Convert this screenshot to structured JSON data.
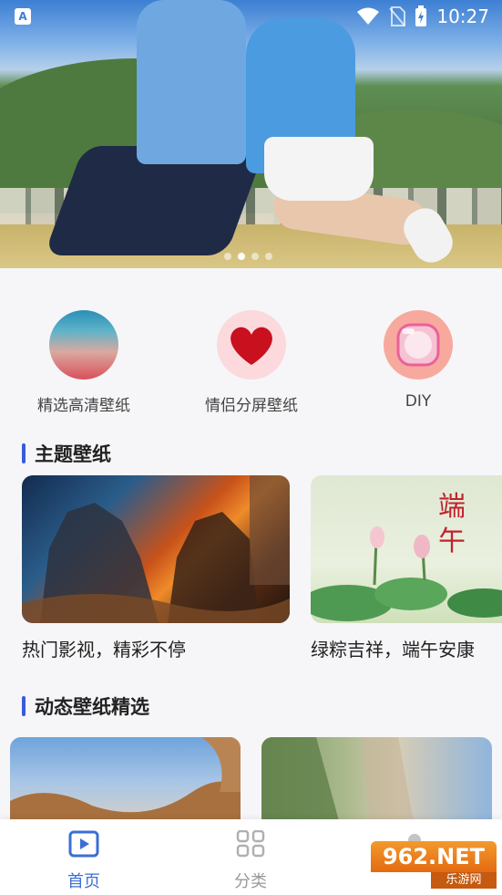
{
  "status_bar": {
    "time": "10:27",
    "left_icon": "A",
    "icons": [
      "wifi-icon",
      "no-sim-icon",
      "battery-charging-icon"
    ]
  },
  "banner": {
    "page_count": 4,
    "active_index": 1
  },
  "quick_categories": [
    {
      "label": "精选高清壁纸",
      "icon": "hd-wallpaper-icon"
    },
    {
      "label": "情侣分屏壁纸",
      "icon": "heart-icon"
    },
    {
      "label": "DIY",
      "icon": "diy-icon"
    }
  ],
  "theme_section": {
    "title": "主题壁纸",
    "cards": [
      {
        "caption": "热门影视，精彩不停"
      },
      {
        "caption": "绿粽吉祥，端午安康",
        "art_text": "端午"
      }
    ]
  },
  "live_section": {
    "title": "动态壁纸精选"
  },
  "bottom_nav": {
    "items": [
      {
        "label": "首页",
        "icon": "play-icon",
        "active": true
      },
      {
        "label": "分类",
        "icon": "grid-icon",
        "active": false
      }
    ]
  },
  "colors": {
    "accent": "#3a5bd9",
    "nav_active": "#3b6fd4",
    "nav_inactive": "#9a9a9a"
  },
  "watermark": {
    "brand": "962.NET",
    "subtitle": "乐游网"
  }
}
